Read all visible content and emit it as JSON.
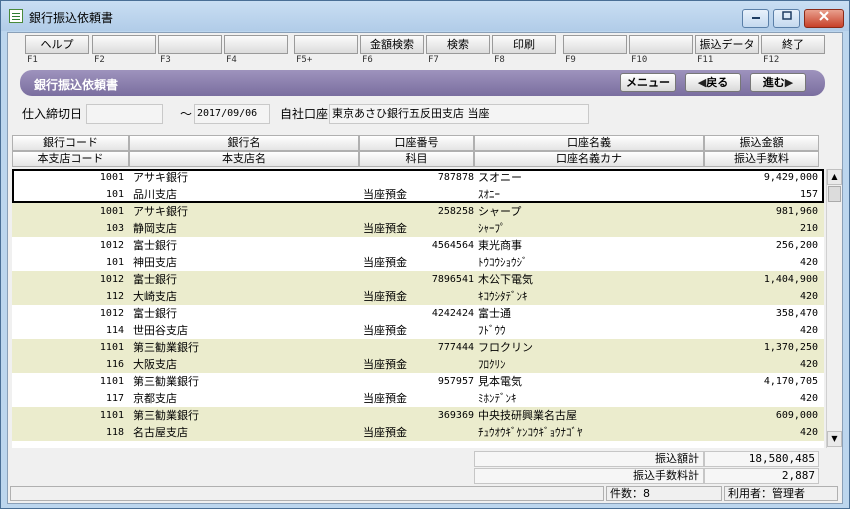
{
  "window": {
    "title": "銀行振込依頼書"
  },
  "fkeys": [
    {
      "label": "ヘルプ",
      "key": "F1"
    },
    {
      "label": "",
      "key": "F2"
    },
    {
      "label": "",
      "key": "F3"
    },
    {
      "label": "",
      "key": "F4"
    },
    {
      "label": "",
      "key": "F5+"
    },
    {
      "label": "金額検索",
      "key": "F6"
    },
    {
      "label": "検索",
      "key": "F7"
    },
    {
      "label": "印刷",
      "key": "F8"
    },
    {
      "label": "",
      "key": "F9"
    },
    {
      "label": "",
      "key": "F10"
    },
    {
      "label": "振込データ",
      "key": "F11"
    },
    {
      "label": "終了",
      "key": "F12"
    }
  ],
  "banner": {
    "title": "銀行振込依頼書",
    "menu": "メニュー",
    "back": "戻る",
    "next": "進む",
    "back_arrow": "◀",
    "next_arrow": "▶"
  },
  "conditions": {
    "cutoff_label": "仕入締切日",
    "cutoff_from": "",
    "tilde": "～",
    "cutoff_to": "2017/09/06",
    "account_label": "自社口座",
    "account_value": "東京あさひ銀行五反田支店 当座"
  },
  "columns": {
    "row1": [
      "銀行コード",
      "銀行名",
      "口座番号",
      "口座名義",
      "振込金額"
    ],
    "row2": [
      "本支店コード",
      "本支店名",
      "科目",
      "口座名義カナ",
      "振込手数料"
    ]
  },
  "records": [
    {
      "bank_code": "1001",
      "bank_name": "アサキ銀行",
      "account_no": "787878",
      "holder": "スオニー",
      "amount": "9,429,000",
      "branch_code": "101",
      "branch_name": "品川支店",
      "subject": "当座預金",
      "kana": "ｽｵﾆｰ",
      "fee": "157"
    },
    {
      "bank_code": "1001",
      "bank_name": "アサキ銀行",
      "account_no": "258258",
      "holder": "シャープ",
      "amount": "981,960",
      "branch_code": "103",
      "branch_name": "静岡支店",
      "subject": "当座預金",
      "kana": "ｼｬｰﾌﾟ",
      "fee": "210"
    },
    {
      "bank_code": "1012",
      "bank_name": "富士銀行",
      "account_no": "4564564",
      "holder": "東光商事",
      "amount": "256,200",
      "branch_code": "101",
      "branch_name": "神田支店",
      "subject": "当座預金",
      "kana": "ﾄｳｺｳｼｮｳｼﾞ",
      "fee": "420"
    },
    {
      "bank_code": "1012",
      "bank_name": "富士銀行",
      "account_no": "7896541",
      "holder": "木公下電気",
      "amount": "1,404,900",
      "branch_code": "112",
      "branch_name": "大崎支店",
      "subject": "当座預金",
      "kana": "ｷｺｳｼﾀﾃﾞﾝｷ",
      "fee": "420"
    },
    {
      "bank_code": "1012",
      "bank_name": "富士銀行",
      "account_no": "4242424",
      "holder": "富士通",
      "amount": "358,470",
      "branch_code": "114",
      "branch_name": "世田谷支店",
      "subject": "当座預金",
      "kana": "ﾌﾄﾞｳｳ",
      "fee": "420"
    },
    {
      "bank_code": "1101",
      "bank_name": "第三勧業銀行",
      "account_no": "777444",
      "holder": "フロクリン",
      "amount": "1,370,250",
      "branch_code": "116",
      "branch_name": "大阪支店",
      "subject": "当座預金",
      "kana": "ﾌﾛｸﾘﾝ",
      "fee": "420"
    },
    {
      "bank_code": "1101",
      "bank_name": "第三勧業銀行",
      "account_no": "957957",
      "holder": "見本電気",
      "amount": "4,170,705",
      "branch_code": "117",
      "branch_name": "京都支店",
      "subject": "当座預金",
      "kana": "ﾐﾎﾝﾃﾞﾝｷ",
      "fee": "420"
    },
    {
      "bank_code": "1101",
      "bank_name": "第三勧業銀行",
      "account_no": "369369",
      "holder": "中央技研興業名古屋",
      "amount": "609,000",
      "branch_code": "118",
      "branch_name": "名古屋支店",
      "subject": "当座預金",
      "kana": "ﾁｭｳｵｳｷﾞｹﾝｺｳｷﾞｮｳﾅｺﾞﾔ",
      "fee": "420"
    }
  ],
  "totals": {
    "amount_label": "振込額計",
    "amount_value": "18,580,485",
    "fee_label": "振込手数料計",
    "fee_value": "2,887"
  },
  "status": {
    "count": "件数：8",
    "user": "利用者：管理者"
  }
}
